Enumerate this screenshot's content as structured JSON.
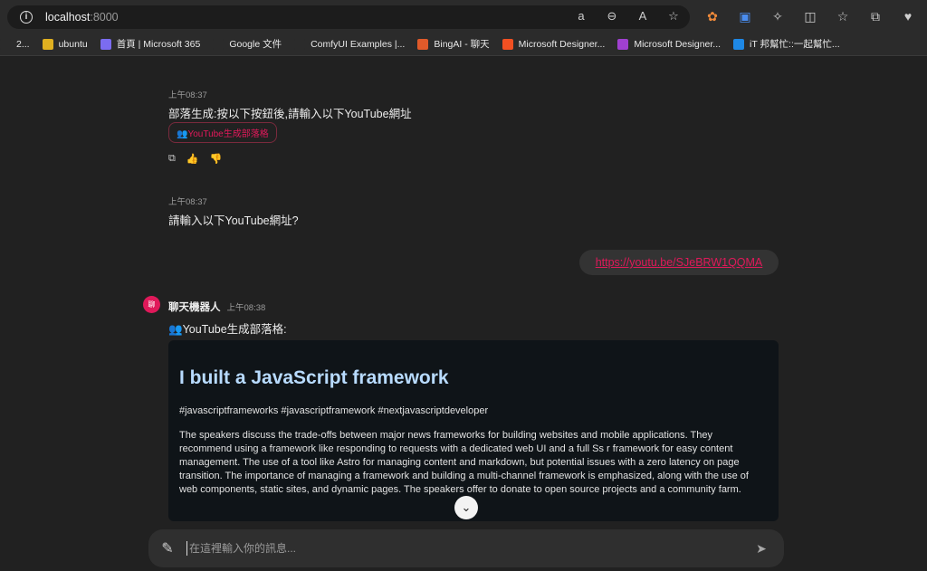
{
  "browser": {
    "url_host": "localhost",
    "url_port": ":8000",
    "addr_icons": [
      "read-aloud-icon",
      "zoom-out-icon",
      "text-size-icon",
      "favorite-star-icon"
    ],
    "toolbar_icons": [
      "extension-orange-icon",
      "translate-icon",
      "puzzle-icon",
      "split-screen-icon",
      "favorites-icon",
      "collections-icon",
      "health-icon"
    ]
  },
  "bookmarks": [
    {
      "label": "2...",
      "color": "#2b2b2b"
    },
    {
      "label": "ubuntu",
      "color": "#e0b020"
    },
    {
      "label": "首頁 | Microsoft 365",
      "color": "#7b6cf0"
    },
    {
      "label": "Google 文件",
      "color": "#2b2b2b"
    },
    {
      "label": "ComfyUI Examples |...",
      "color": "#2b2b2b"
    },
    {
      "label": "BingAI - 聊天",
      "color": "#e05a2a"
    },
    {
      "label": "Microsoft Designer...",
      "color": "#f25022"
    },
    {
      "label": "Microsoft Designer...",
      "color": "#a040d0"
    },
    {
      "label": "iT 邦幫忙::一起幫忙...",
      "color": "#1e88e5"
    }
  ],
  "chat": {
    "msg1": {
      "timestamp": "上午08:37",
      "text": "部落生成:按以下按鈕後,請輸入以下YouTube網址",
      "chip": "👥YouTube生成部落格"
    },
    "msg2": {
      "timestamp": "上午08:37",
      "text": "請輸入以下YouTube網址?"
    },
    "user_link": "https://youtu.be/SJeBRW1QQMA",
    "bot": {
      "avatar_text": "聊",
      "name": "聊天機器人",
      "timestamp": "上午08:38",
      "intro": "👥YouTube生成部落格:",
      "card_title": "I built a JavaScript framework",
      "card_tags": "#javascriptframeworks #javascriptframework #nextjavascriptdeveloper",
      "card_body": "The speakers discuss the trade-offs between major news frameworks for building websites and mobile applications. They recommend using a framework like responding to requests with a dedicated web UI and a full Ss r framework for easy content management. The use of a tool like Astro for managing content and markdown, but potential issues with a zero latency on page transition. The importance of managing a framework and building a multi-channel framework is emphasized, along with the use of web components, static sites, and dynamic pages. The speakers offer to donate to open source projects and a community farm."
    }
  },
  "composer": {
    "placeholder": "在這裡輸入你的訊息..."
  },
  "colors": {
    "accent": "#e0195a",
    "card_title": "#b8dbff"
  }
}
